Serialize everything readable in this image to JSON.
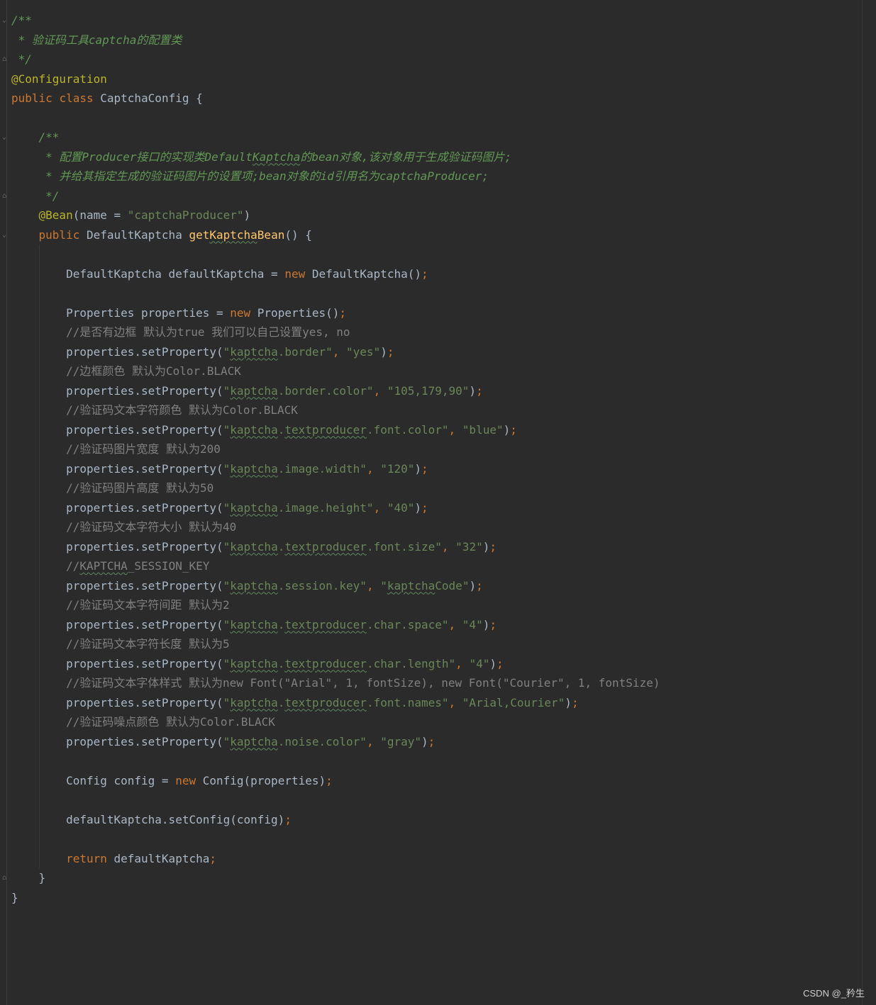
{
  "editor": {
    "language": "java",
    "theme_colors": {
      "background": "#2b2b2b",
      "keyword": "#cc7832",
      "string": "#6a8759",
      "doc_comment": "#629755",
      "comment": "#808080",
      "annotation": "#bbb529",
      "method": "#ffc66d",
      "text": "#a9b7c6"
    },
    "code": {
      "l1": "/**",
      "l2": " * 验证码工具captcha的配置类",
      "l3": " */",
      "l4": "@Configuration",
      "l5_kw1": "public",
      "l5_kw2": "class",
      "l5_rest": " CaptchaConfig {",
      "l7": "/**",
      "l8_a": " * 配置Producer接口的实现类Default",
      "l8_sq": "Kaptcha",
      "l8_b": "的bean对象,该对象用于生成验证码图片;",
      "l9": " * 并给其指定生成的验证码图片的设置项;bean对象的id引用名为captchaProducer;",
      "l10": " */",
      "l11_ann": "@Bean",
      "l11_a": "(name = ",
      "l11_str": "\"captchaProducer\"",
      "l11_b": ")",
      "l12_kw": "public",
      "l12_a": " DefaultKaptcha ",
      "l12_fn_a": "get",
      "l12_fn_sq": "Kaptcha",
      "l12_fn_b": "Bean",
      "l12_b": "() {",
      "l14_a": "DefaultKaptcha defaultKaptcha = ",
      "l14_kw": "new",
      "l14_b": " DefaultKaptcha()",
      "l16_a": "Properties properties = ",
      "l16_kw": "new",
      "l16_b": " Properties()",
      "semi": ";",
      "set_call": "properties.setProperty(",
      "q": "\"",
      "sep": ", ",
      "close": ")",
      "kaptcha": "kaptcha",
      "textproducer": "textproducer",
      "c1": "//是否有边框 默认为true 我们可以自己设置yes, no",
      "p1_rest": ".border\"",
      "p1_val": "\"yes\"",
      "c2": "//边框颜色 默认为Color.BLACK",
      "p2_rest": ".border.color\"",
      "p2_val": "\"105,179,90\"",
      "c3": "//验证码文本字符颜色 默认为Color.BLACK",
      "p3_rest": ".font.color\"",
      "p3_val": "\"blue\"",
      "c4": "//验证码图片宽度 默认为200",
      "p4_rest": ".image.width\"",
      "p4_val": "\"120\"",
      "c5": "//验证码图片高度 默认为50",
      "p5_rest": ".image.height\"",
      "p5_val": "\"40\"",
      "c6": "//验证码文本字符大小 默认为40",
      "p6_rest": ".font.size\"",
      "p6_val": "\"32\"",
      "c7_a": "//",
      "c7_sq": "KAPTCHA",
      "c7_b": "_SESSION_KEY",
      "p7_rest": ".session.key\"",
      "p7_val_sq": "kaptcha",
      "p7_val_rest": "Code\"",
      "c8": "//验证码文本字符间距 默认为2",
      "p8_rest": ".char.space\"",
      "p8_val": "\"4\"",
      "c9": "//验证码文本字符长度 默认为5",
      "p9_rest": ".char.length\"",
      "p9_val": "\"4\"",
      "c10": "//验证码文本字体样式 默认为new Font(\"Arial\", 1, fontSize), new Font(\"Courier\", 1, fontSize)",
      "p10_rest": ".font.names\"",
      "p10_val": "\"Arial,Courier\"",
      "c11": "//验证码噪点颜色 默认为Color.BLACK",
      "p11_rest": ".noise.color\"",
      "p11_val": "\"gray\"",
      "l_cfg_a": "Config config = ",
      "l_cfg_kw": "new",
      "l_cfg_b": " Config(properties)",
      "l_set": "defaultKaptcha.setConfig(config)",
      "l_ret_kw": "return",
      "l_ret_b": " defaultKaptcha",
      "l_close_method": "}",
      "l_close_class": "}"
    }
  },
  "watermark": "CSDN @_矜生"
}
